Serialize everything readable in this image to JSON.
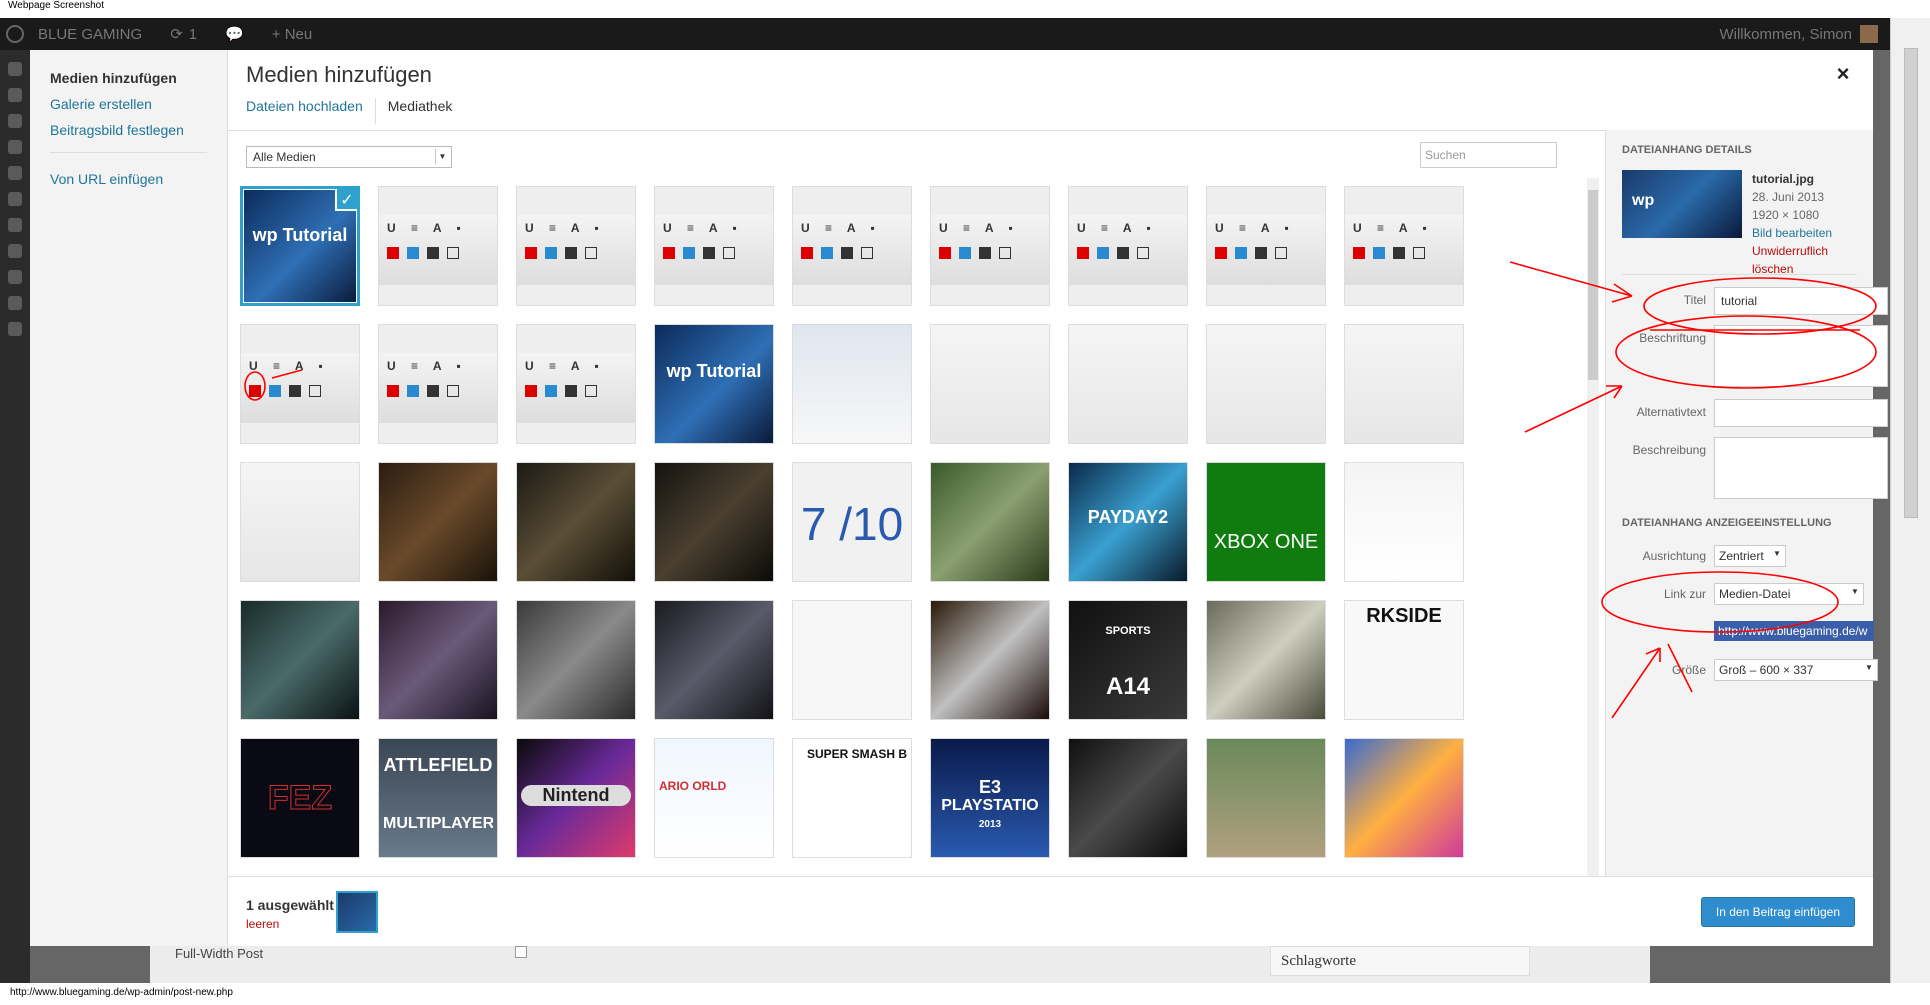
{
  "page": {
    "label": "Webpage Screenshot"
  },
  "adminbar": {
    "site": "BLUE GAMING",
    "updates": "1",
    "new": "+ Neu",
    "greeting": "Willkommen, Simon"
  },
  "modal": {
    "menu": {
      "insert_media": "Medien hinzufügen",
      "create_gallery": "Galerie erstellen",
      "featured_image": "Beitragsbild festlegen",
      "from_url": "Von URL einfügen"
    },
    "title": "Medien hinzufügen",
    "close": "×",
    "tabs": [
      {
        "label": "Dateien hochladen"
      },
      {
        "label": "Mediathek"
      }
    ],
    "filter": {
      "value": "Alle Medien"
    },
    "search": {
      "placeholder": "Suchen"
    },
    "grid": {
      "rows": [
        [
          "wp-tutorial",
          "editor-toolbar",
          "editor-toolbar",
          "editor-toolbar",
          "editor-toolbar",
          "editor-toolbar",
          "editor-toolbar",
          "editor-toolbar",
          "editor-toolbar"
        ],
        [
          "editor-toolbar",
          "editor-toolbar",
          "editor-toolbar",
          "wp-tutorial",
          "podcast",
          "screenshot",
          "screenshot",
          "screenshot",
          "screenshot"
        ],
        [
          "screenshot",
          "dark-room",
          "dark-cave",
          "dark-hall",
          "score",
          "forest",
          "payday",
          "xbox-one",
          "ps4"
        ],
        [
          "scifi",
          "city",
          "figure",
          "street",
          "chart",
          "action",
          "fifa",
          "soldier",
          "darkside"
        ],
        [
          "fez",
          "battlefield",
          "nintendo",
          "mario-world",
          "smash",
          "e3-playstation",
          "shooter",
          "rally",
          "colorful"
        ]
      ],
      "labels": {
        "score_main": "7",
        "score_sub": "/10",
        "payday": "PAYDAY2",
        "xbox": "XBOX ONE",
        "battlefield_1": "ATTLEFIELD",
        "battlefield_2": "MULTIPLAYER",
        "nintendo": "Nintend",
        "fifa": "A14",
        "fifa_brand": "SPORTS",
        "darkside": "RKSIDE",
        "e3_1": "E3",
        "e3_2": "PLAYSTATIO",
        "e3_year": "2013",
        "smash": "SUPER SMASH B",
        "mario": "ARIO ORLD",
        "fez": "FEZ",
        "wp_logo": "wp",
        "wp_logo_sub": "Tutorial"
      },
      "selected_index": 0
    },
    "details": {
      "heading": "DATEIANHANG DETAILS",
      "filename": "tutorial.jpg",
      "date": "28. Juni 2013",
      "dimensions": "1920 × 1080",
      "edit": "Bild bearbeiten",
      "delete": "Unwiderruflich löschen",
      "fields": {
        "title_label": "Titel",
        "title_value": "tutorial",
        "caption_label": "Beschriftung",
        "alt_label": "Alternativtext",
        "desc_label": "Beschreibung"
      }
    },
    "display": {
      "heading": "DATEIANHANG ANZEIGEEINSTELLUNG",
      "align_label": "Ausrichtung",
      "align_value": "Zentriert",
      "link_label": "Link zur",
      "link_value": "Medien-Datei",
      "url_value": "http://www.bluegaming.de/w",
      "size_label": "Größe",
      "size_value": "Groß – 600 × 337"
    },
    "footer": {
      "count": "1 ausgewählt",
      "clear": "leeren",
      "insert": "In den Beitrag einfügen"
    }
  },
  "background": {
    "fullwidth": "Full-Width Post",
    "schlagworte": "Schlagworte"
  },
  "status_url": "http://www.bluegaming.de/wp-admin/post-new.php",
  "colors": {
    "accent": "#2ea2cc",
    "link": "#21759b",
    "danger": "#bc0b0b",
    "annotation": "#ff0000"
  }
}
